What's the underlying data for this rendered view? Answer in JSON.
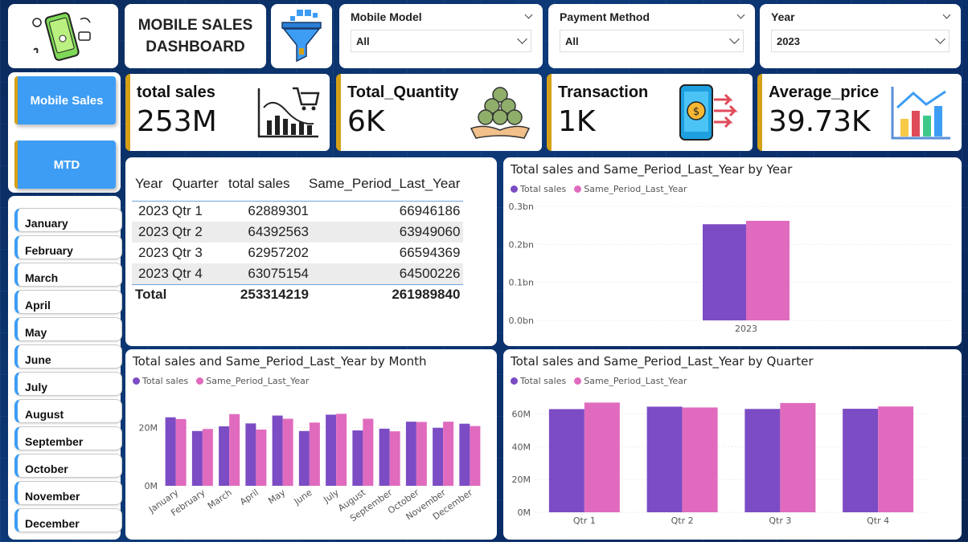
{
  "title_line1": "MOBILE SALES",
  "title_line2": "DASHBOARD",
  "slicers": [
    {
      "label": "Mobile Model",
      "value": "All"
    },
    {
      "label": "Payment Method",
      "value": "All"
    },
    {
      "label": "Year",
      "value": "2023"
    }
  ],
  "nav": {
    "mobile_sales": "Mobile Sales",
    "mtd": "MTD"
  },
  "months": [
    "January",
    "February",
    "March",
    "April",
    "May",
    "June",
    "July",
    "August",
    "September",
    "October",
    "November",
    "December"
  ],
  "kpis": {
    "sales": {
      "title": "total sales",
      "value": "253M"
    },
    "quantity": {
      "title": "Total_Quantity",
      "value": "6K"
    },
    "transaction": {
      "title": "Transaction",
      "value": "1K"
    },
    "average": {
      "title": "Average_price",
      "value": "39.73K"
    }
  },
  "table": {
    "headers": [
      "Year",
      "Quarter",
      "total sales",
      "Same_Period_Last_Year"
    ],
    "rows": [
      [
        "2023",
        "Qtr 1",
        "62889301",
        "66946186"
      ],
      [
        "2023",
        "Qtr 2",
        "64392563",
        "63949060"
      ],
      [
        "2023",
        "Qtr 3",
        "62957202",
        "66594369"
      ],
      [
        "2023",
        "Qtr 4",
        "63075154",
        "64500226"
      ]
    ],
    "total": [
      "Total",
      "253314219",
      "261989840"
    ]
  },
  "colors": {
    "total_sales": "#7b4cc4",
    "same_period": "#e06bbe",
    "accent": "#3d9df5",
    "gold": "#d4a017"
  },
  "chart_data": [
    {
      "type": "bar",
      "title": "Total sales and Same_Period_Last_Year by Year",
      "categories": [
        "2023"
      ],
      "series": [
        {
          "name": "Total sales",
          "values": [
            0.253
          ]
        },
        {
          "name": "Same_Period_Last_Year",
          "values": [
            0.262
          ]
        }
      ],
      "yticks": [
        "0.0bn",
        "0.1bn",
        "0.2bn",
        "0.3bn"
      ],
      "ylim": [
        0,
        0.3
      ]
    },
    {
      "type": "bar",
      "title": "Total sales and Same_Period_Last_Year by Month",
      "categories": [
        "January",
        "February",
        "March",
        "April",
        "May",
        "June",
        "July",
        "August",
        "September",
        "October",
        "November",
        "December"
      ],
      "series": [
        {
          "name": "Total sales",
          "values": [
            23.5,
            18.8,
            20.4,
            21.4,
            24.1,
            18.8,
            24.4,
            19.0,
            19.6,
            22.0,
            19.9,
            21.3
          ]
        },
        {
          "name": "Same_Period_Last_Year",
          "values": [
            22.9,
            19.5,
            24.6,
            19.3,
            23.0,
            21.7,
            24.7,
            23.0,
            18.7,
            21.9,
            22.0,
            20.5
          ]
        }
      ],
      "yticks": [
        "0M",
        "20M"
      ],
      "ylim": [
        0,
        27
      ]
    },
    {
      "type": "bar",
      "title": "Total sales and Same_Period_Last_Year by Quarter",
      "categories": [
        "Qtr 1",
        "Qtr 2",
        "Qtr 3",
        "Qtr 4"
      ],
      "series": [
        {
          "name": "Total sales",
          "values": [
            62.9,
            64.4,
            63.0,
            63.1
          ]
        },
        {
          "name": "Same_Period_Last_Year",
          "values": [
            66.9,
            63.9,
            66.6,
            64.5
          ]
        }
      ],
      "yticks": [
        "0M",
        "20M",
        "40M",
        "60M"
      ],
      "ylim": [
        0,
        70
      ]
    }
  ]
}
